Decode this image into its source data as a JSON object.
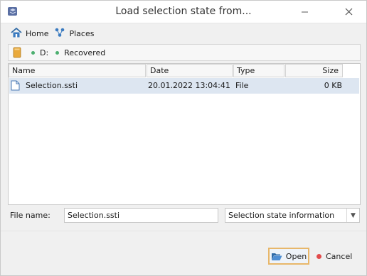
{
  "window": {
    "title": "Load selection state from..."
  },
  "titlebar": {
    "minimize_icon": "minimize-icon",
    "close_icon": "close-icon"
  },
  "nav": {
    "home_label": "Home",
    "places_label": "Places"
  },
  "breadcrumb": {
    "items": [
      "D:",
      "Recovered"
    ],
    "status_color": "#4caf70"
  },
  "file_list": {
    "columns": [
      "Name",
      "Date",
      "Type",
      "Size"
    ],
    "rows": [
      {
        "name": "Selection.ssti",
        "date": "20.01.2022 13:04:41",
        "type": "File",
        "size": "0 KB",
        "selected": true
      }
    ]
  },
  "filename": {
    "label": "File name:",
    "value": "Selection.ssti"
  },
  "filetype": {
    "selected": "Selection state information"
  },
  "buttons": {
    "open_label": "Open",
    "cancel_label": "Cancel"
  },
  "colors": {
    "accent": "#e8b76a",
    "selection": "#dde6f1",
    "cancel": "#e24b4b"
  }
}
